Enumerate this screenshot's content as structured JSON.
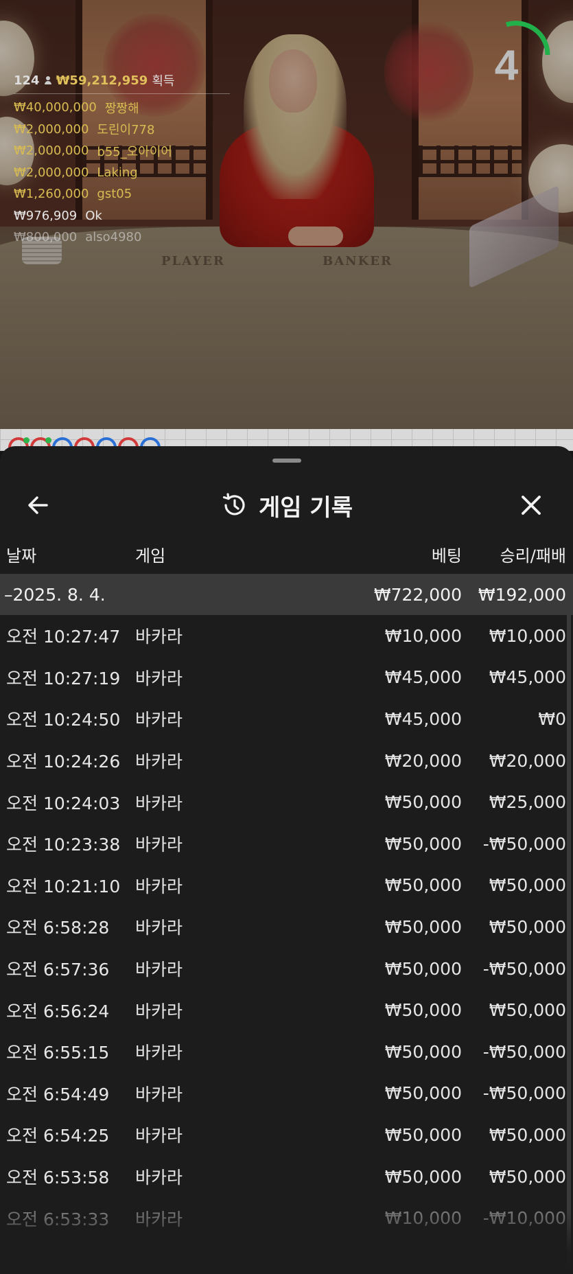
{
  "live": {
    "countdown": "4",
    "countdown_color": "#22b04a",
    "summary": {
      "count": "124",
      "amount": "₩59,212,959",
      "word": "획득"
    },
    "winners": [
      {
        "amount": "₩40,000,000",
        "name": "짱짱해",
        "style": "gold"
      },
      {
        "amount": "₩2,000,000",
        "name": "도린이778",
        "style": "gold"
      },
      {
        "amount": "₩2,000,000",
        "name": "b55_오아이어",
        "style": "gold"
      },
      {
        "amount": "₩2,000,000",
        "name": "Laking",
        "style": "gold"
      },
      {
        "amount": "₩1,260,000",
        "name": "gst05",
        "style": "gold"
      },
      {
        "amount": "₩976,909",
        "name": "Ok",
        "style": "white"
      },
      {
        "amount": "₩800,000",
        "name": "also4980",
        "style": "faded"
      }
    ],
    "table_labels": {
      "player": "PLAYER",
      "banker": "BANKER"
    }
  },
  "road": {
    "colors": {
      "player": "#2a6fd6",
      "banker": "#d23a3a",
      "pair": "#2fb34a"
    },
    "dots": [
      "banker",
      "banker",
      "player",
      "banker",
      "player",
      "banker",
      "player"
    ]
  },
  "sheet": {
    "title": "게임 기록",
    "columns": {
      "date": "날짜",
      "game": "게임",
      "bet": "베팅",
      "result": "승리/패배"
    },
    "date_group": {
      "date": "–2025. 8. 4.",
      "bet": "₩722,000",
      "result": "₩192,000"
    },
    "rows": [
      {
        "time": "오전 10:27:47",
        "game": "바카라",
        "bet": "₩10,000",
        "result": "₩10,000"
      },
      {
        "time": "오전 10:27:19",
        "game": "바카라",
        "bet": "₩45,000",
        "result": "₩45,000"
      },
      {
        "time": "오전 10:24:50",
        "game": "바카라",
        "bet": "₩45,000",
        "result": "₩0"
      },
      {
        "time": "오전 10:24:26",
        "game": "바카라",
        "bet": "₩20,000",
        "result": "₩20,000"
      },
      {
        "time": "오전 10:24:03",
        "game": "바카라",
        "bet": "₩50,000",
        "result": "₩25,000"
      },
      {
        "time": "오전 10:23:38",
        "game": "바카라",
        "bet": "₩50,000",
        "result": "-₩50,000"
      },
      {
        "time": "오전 10:21:10",
        "game": "바카라",
        "bet": "₩50,000",
        "result": "₩50,000"
      },
      {
        "time": "오전 6:58:28",
        "game": "바카라",
        "bet": "₩50,000",
        "result": "₩50,000"
      },
      {
        "time": "오전 6:57:36",
        "game": "바카라",
        "bet": "₩50,000",
        "result": "-₩50,000"
      },
      {
        "time": "오전 6:56:24",
        "game": "바카라",
        "bet": "₩50,000",
        "result": "₩50,000"
      },
      {
        "time": "오전 6:55:15",
        "game": "바카라",
        "bet": "₩50,000",
        "result": "-₩50,000"
      },
      {
        "time": "오전 6:54:49",
        "game": "바카라",
        "bet": "₩50,000",
        "result": "-₩50,000"
      },
      {
        "time": "오전 6:54:25",
        "game": "바카라",
        "bet": "₩50,000",
        "result": "₩50,000"
      },
      {
        "time": "오전 6:53:58",
        "game": "바카라",
        "bet": "₩50,000",
        "result": "₩50,000"
      },
      {
        "time": "오전 6:53:33",
        "game": "바카라",
        "bet": "₩10,000",
        "result": "-₩10,000"
      }
    ],
    "icons": {
      "back": "arrow-left-icon",
      "history": "history-clock-icon",
      "close": "close-icon"
    }
  }
}
